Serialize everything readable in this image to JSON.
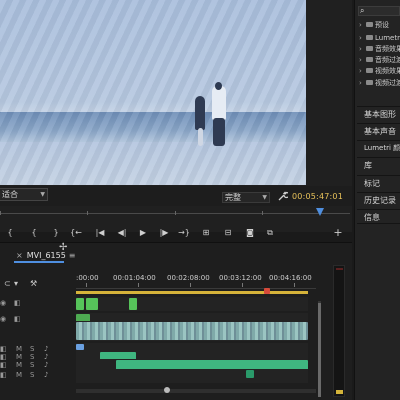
{
  "program_monitor": {
    "fit_label": "适合",
    "quality_label": "完整",
    "timecode": "00:05:47:01"
  },
  "right_panel": {
    "search_glyph": "⌕",
    "tree": [
      {
        "label": "预设"
      },
      {
        "label": "Lumetri 预设"
      },
      {
        "label": "音频效果"
      },
      {
        "label": "音频过渡"
      },
      {
        "label": "视频效果"
      },
      {
        "label": "视频过渡"
      }
    ],
    "tabs": [
      "基本图形",
      "基本声音",
      "Lumetri 颜色",
      "库",
      "标记",
      "历史记录",
      "信息"
    ]
  },
  "timeline": {
    "sequence_name": "MVI_6155",
    "close_glyph": "×",
    "menu_glyph": "≡",
    "ruler_labels": [
      ":00:00",
      "00:01:04:00",
      "00:02:08:00",
      "00:03:12:00",
      "00:04:16:00"
    ]
  },
  "icons": {
    "wrench": "wrench-icon",
    "play": "play-icon",
    "add": "add-icon",
    "camera": "camera-icon",
    "eye": "eye-icon",
    "lock": "lock-icon"
  },
  "colors": {
    "accent_blue": "#4f8fe0",
    "timecode_yellow": "#e8c25a",
    "video_clip_green": "#56c35a",
    "audio_clip_green": "#3fb680"
  }
}
